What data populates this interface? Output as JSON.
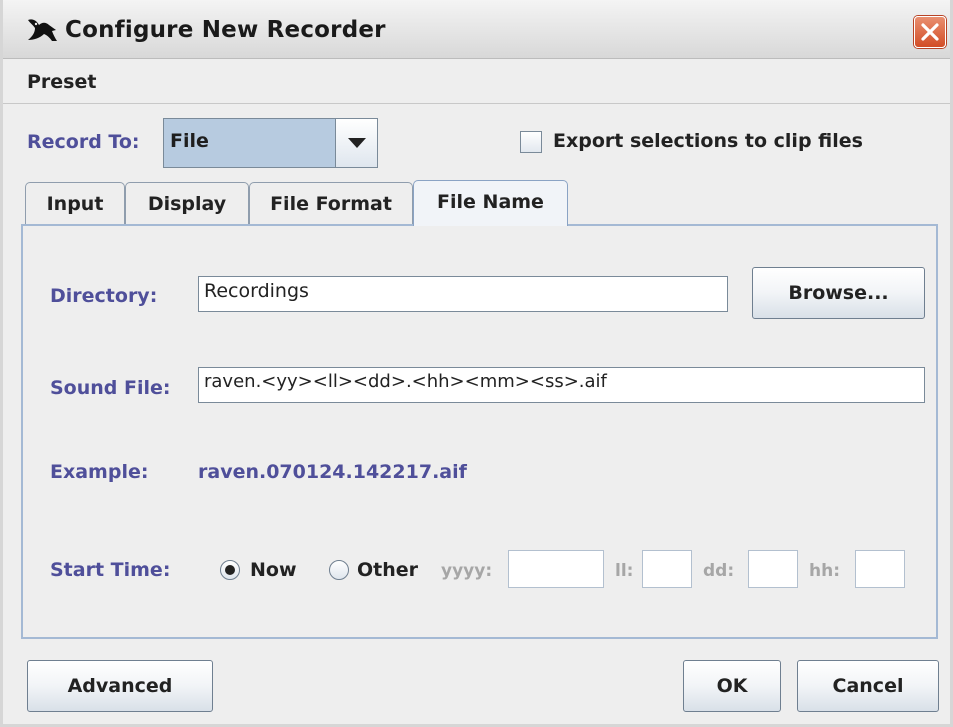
{
  "window": {
    "title": "Configure New Recorder",
    "close_icon": "close-icon",
    "close_color": "#d9522b"
  },
  "menubar": {
    "items": [
      "Preset"
    ]
  },
  "record_to": {
    "label": "Record To:",
    "value": "File",
    "export_checkbox_label": "Export selections to clip files",
    "export_checked": false
  },
  "tabs": [
    {
      "label": "Input",
      "active": false
    },
    {
      "label": "Display",
      "active": false
    },
    {
      "label": "File Format",
      "active": false
    },
    {
      "label": "File Name",
      "active": true
    }
  ],
  "file_name_tab": {
    "directory_label": "Directory:",
    "directory_value": "Recordings",
    "browse_label": "Browse...",
    "sound_file_label": "Sound File:",
    "sound_file_value": "raven.<yy><ll><dd>.<hh><mm><ss>.aif",
    "example_label": "Example:",
    "example_value": "raven.070124.142217.aif",
    "start_time_label": "Start Time:",
    "radio_now_label": "Now",
    "radio_other_label": "Other",
    "selected_start": "Now",
    "yyyy_label": "yyyy:",
    "ll_label": "ll:",
    "dd_label": "dd:",
    "hh_label": "hh:"
  },
  "footer": {
    "advanced_label": "Advanced",
    "ok_label": "OK",
    "cancel_label": "Cancel"
  },
  "colors": {
    "label_accent": "#4f4f9a",
    "combo_background": "#b7cbe0",
    "panel_border": "#a4b9d4"
  }
}
